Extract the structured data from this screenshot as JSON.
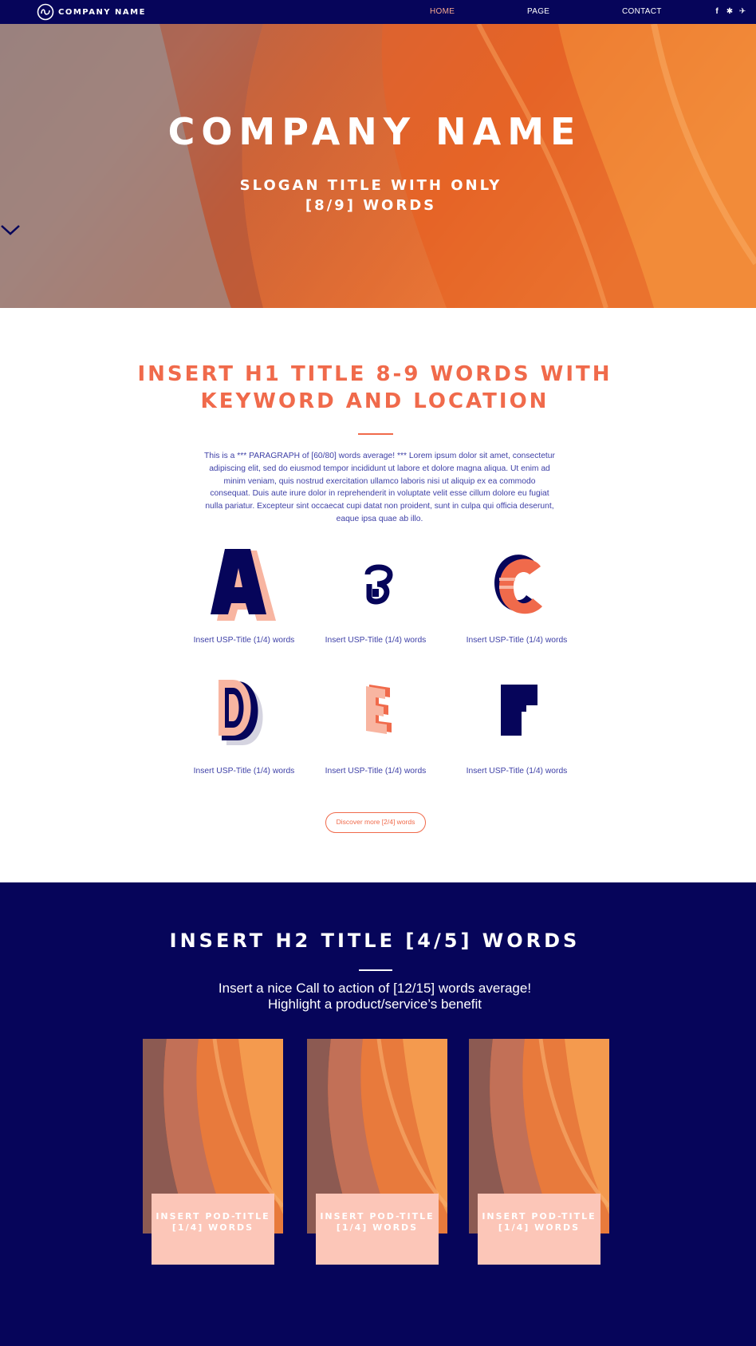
{
  "nav": {
    "brand": "COMPANY NAME",
    "menu": [
      {
        "label": "HOME",
        "active": true
      },
      {
        "label": "PAGE",
        "active": false
      },
      {
        "label": "CONTACT",
        "active": false
      }
    ],
    "socials": [
      "facebook-icon",
      "yelp-icon",
      "twitter-icon"
    ]
  },
  "hero": {
    "title": "COMPANY NAME",
    "slogan_line1": "SLOGAN TITLE WITH ONLY",
    "slogan_line2": "[8/9] WORDS"
  },
  "intro": {
    "h1_line1": "INSERT H1 TITLE 8-9 WORDS WITH",
    "h1_line2": "KEYWORD AND LOCATION",
    "paragraph": "This is a *** PARAGRAPH of [60/80] words average! *** Lorem ipsum dolor sit amet, consectetur adipiscing elit, sed do eiusmod tempor incididunt ut labore et dolore magna aliqua. Ut enim ad minim veniam, quis nostrud exercitation ullamco laboris nisi ut aliquip ex ea commodo consequat. Duis aute irure dolor in reprehenderit in voluptate velit esse cillum dolore eu fugiat nulla pariatur. Excepteur sint occaecat cupi datat non proident, sunt in culpa qui officia deserunt, eaque ipsa quae ab illo.",
    "usps": [
      {
        "icon": "letter-a-icon",
        "label": "Insert USP-Title (1/4) words"
      },
      {
        "icon": "letter-b-icon",
        "label": "Insert USP-Title (1/4) words"
      },
      {
        "icon": "letter-c-icon",
        "label": "Insert USP-Title (1/4) words"
      },
      {
        "icon": "letter-d-icon",
        "label": "Insert USP-Title (1/4) words"
      },
      {
        "icon": "letter-e-icon",
        "label": "Insert USP-Title (1/4) words"
      },
      {
        "icon": "letter-f-icon",
        "label": "Insert USP-Title (1/4) words"
      }
    ],
    "discover_label": "Discover more [2/4] words"
  },
  "products": {
    "h2": "INSERT H2 TITLE [4/5] WORDS",
    "cta_line1": "Insert a nice Call to action of [12/15] words average!",
    "cta_line2": "Highlight a product/service’s benefit",
    "cards": [
      {
        "title": "INSERT POD-TITLE [1/4] WORDS"
      },
      {
        "title": "INSERT POD-TITLE [1/4] WORDS"
      },
      {
        "title": "INSERT POD-TITLE [1/4] WORDS"
      }
    ]
  },
  "colors": {
    "navy": "#06055a",
    "coral": "#f06a4b",
    "peach": "#fcc6b8",
    "text_blue": "#3d3fa6"
  }
}
